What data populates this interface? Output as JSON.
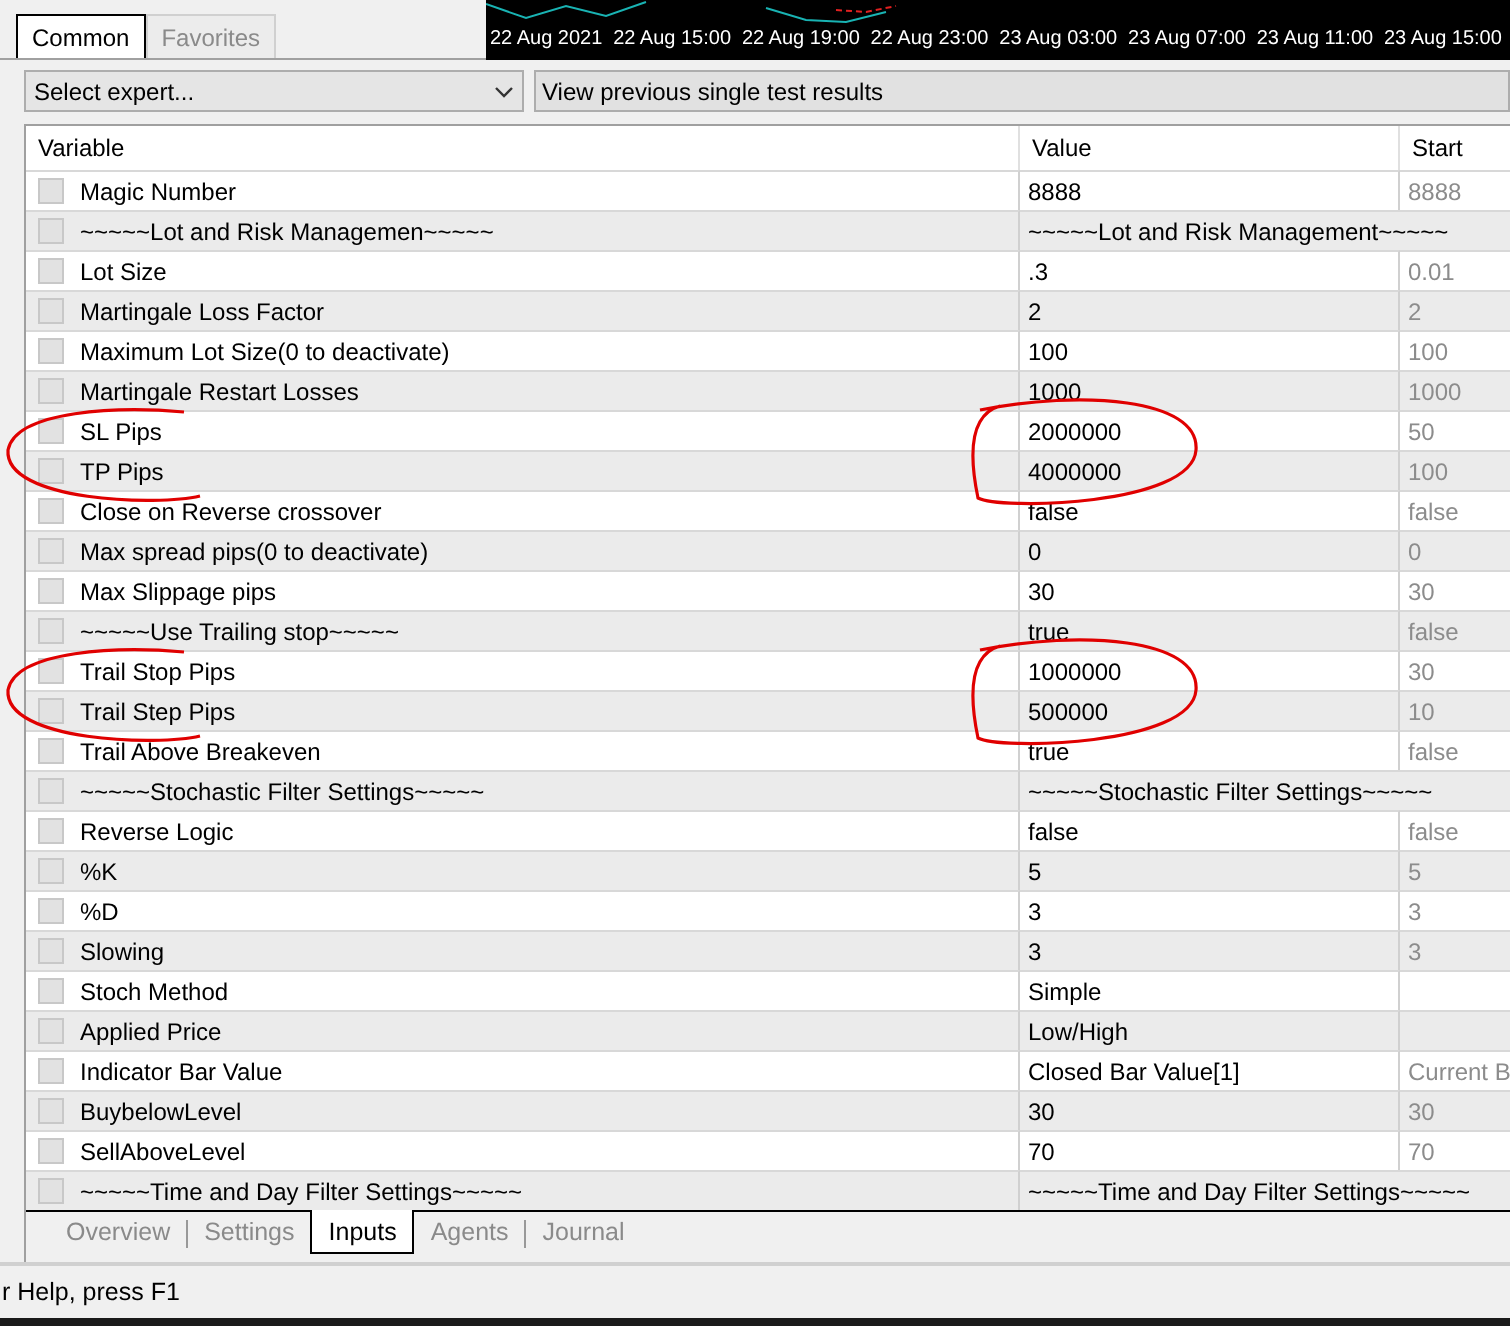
{
  "top_tabs": [
    {
      "label": "Common",
      "selected": true
    },
    {
      "label": "Favorites",
      "selected": false
    }
  ],
  "chart_axis": [
    "22 Aug 2021",
    "22 Aug 15:00",
    "22 Aug 19:00",
    "22 Aug 23:00",
    "23 Aug 03:00",
    "23 Aug 07:00",
    "23 Aug 11:00",
    "23 Aug 15:00"
  ],
  "toolbar": {
    "expert_select": "Select expert...",
    "results_button": "View previous single test results"
  },
  "table": {
    "columns": [
      "Variable",
      "Value",
      "Start"
    ],
    "rows": [
      {
        "kind": "param",
        "checked": false,
        "circled": false,
        "name": "Magic Number",
        "value": "8888",
        "start": "8888"
      },
      {
        "kind": "section",
        "checked": false,
        "circled": false,
        "name": "~~~~~Lot and Risk Managemen~~~~~",
        "value": "~~~~~Lot and Risk Management~~~~~"
      },
      {
        "kind": "param",
        "checked": false,
        "circled": false,
        "name": "Lot Size",
        "value": ".3",
        "start": "0.01"
      },
      {
        "kind": "param",
        "checked": false,
        "circled": false,
        "name": "Martingale Loss Factor",
        "value": "2",
        "start": "2"
      },
      {
        "kind": "param",
        "checked": false,
        "circled": false,
        "name": "Maximum Lot Size(0 to deactivate)",
        "value": "100",
        "start": "100"
      },
      {
        "kind": "param",
        "checked": false,
        "circled": false,
        "name": "Martingale Restart Losses",
        "value": "1000",
        "start": "1000"
      },
      {
        "kind": "param",
        "checked": false,
        "circled": true,
        "name": "SL Pips",
        "value": "2000000",
        "start": "50"
      },
      {
        "kind": "param",
        "checked": false,
        "circled": true,
        "name": "TP Pips",
        "value": "4000000",
        "start": "100"
      },
      {
        "kind": "param",
        "checked": false,
        "circled": false,
        "name": "Close on Reverse crossover",
        "value": "false",
        "start": "false"
      },
      {
        "kind": "param",
        "checked": false,
        "circled": false,
        "name": "Max spread pips(0 to deactivate)",
        "value": "0",
        "start": "0"
      },
      {
        "kind": "param",
        "checked": false,
        "circled": false,
        "name": "Max Slippage pips",
        "value": "30",
        "start": "30"
      },
      {
        "kind": "param",
        "checked": false,
        "circled": false,
        "name": "~~~~~Use Trailing stop~~~~~",
        "value": "true",
        "start": "false"
      },
      {
        "kind": "param",
        "checked": false,
        "circled": true,
        "name": "Trail Stop Pips",
        "value": "1000000",
        "start": "30"
      },
      {
        "kind": "param",
        "checked": false,
        "circled": true,
        "name": "Trail Step Pips",
        "value": "500000",
        "start": "10"
      },
      {
        "kind": "param",
        "checked": false,
        "circled": false,
        "name": "Trail Above Breakeven",
        "value": "true",
        "start": "false"
      },
      {
        "kind": "section",
        "checked": false,
        "circled": false,
        "name": "~~~~~Stochastic Filter Settings~~~~~",
        "value": "~~~~~Stochastic Filter Settings~~~~~"
      },
      {
        "kind": "param",
        "checked": false,
        "circled": false,
        "name": "Reverse Logic",
        "value": "false",
        "start": "false"
      },
      {
        "kind": "param",
        "checked": false,
        "circled": false,
        "name": "%K",
        "value": "5",
        "start": "5"
      },
      {
        "kind": "param",
        "checked": false,
        "circled": false,
        "name": "%D",
        "value": "3",
        "start": "3"
      },
      {
        "kind": "param",
        "checked": false,
        "circled": false,
        "name": "Slowing",
        "value": "3",
        "start": "3"
      },
      {
        "kind": "param",
        "checked": false,
        "circled": false,
        "name": "Stoch Method",
        "value": "Simple"
      },
      {
        "kind": "param",
        "checked": false,
        "circled": false,
        "name": "Applied Price",
        "value": "Low/High"
      },
      {
        "kind": "param",
        "checked": false,
        "circled": false,
        "name": "Indicator Bar Value",
        "value": "Closed Bar Value[1]",
        "start": "Current B"
      },
      {
        "kind": "param",
        "checked": false,
        "circled": false,
        "name": "BuybelowLevel",
        "value": "30",
        "start": "30"
      },
      {
        "kind": "param",
        "checked": false,
        "circled": false,
        "name": "SellAboveLevel",
        "value": "70",
        "start": "70"
      },
      {
        "kind": "section",
        "checked": false,
        "circled": false,
        "name": "~~~~~Time and Day Filter Settings~~~~~",
        "value": "~~~~~Time and Day Filter Settings~~~~~"
      }
    ]
  },
  "bottom_tabs": [
    {
      "label": "Overview",
      "selected": false
    },
    {
      "label": "Settings",
      "selected": false
    },
    {
      "label": "Inputs",
      "selected": true
    },
    {
      "label": "Agents",
      "selected": false
    },
    {
      "label": "Journal",
      "selected": false
    }
  ],
  "status_bar": "r Help, press F1"
}
